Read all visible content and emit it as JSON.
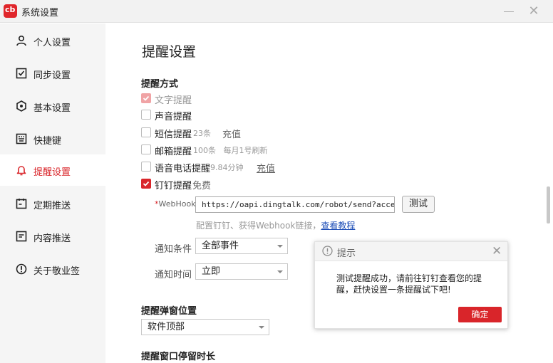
{
  "window": {
    "title": "系统设置"
  },
  "colors": {
    "accent": "#d9252a",
    "link": "#1f4fb8"
  },
  "sidebar": {
    "items": [
      {
        "label": "个人设置",
        "icon": "user-icon"
      },
      {
        "label": "同步设置",
        "icon": "sync-icon"
      },
      {
        "label": "基本设置",
        "icon": "settings-icon"
      },
      {
        "label": "快捷键",
        "icon": "keyboard-icon"
      },
      {
        "label": "提醒设置",
        "icon": "bell-icon",
        "active": true
      },
      {
        "label": "定期推送",
        "icon": "calendar-icon"
      },
      {
        "label": "内容推送",
        "icon": "document-icon"
      },
      {
        "label": "关于敬业签",
        "icon": "info-icon"
      }
    ]
  },
  "main": {
    "page_title": "提醒设置",
    "section_method": "提醒方式",
    "methods": [
      {
        "label": "文字提醒",
        "checked": true,
        "disabled": true
      },
      {
        "label": "声音提醒",
        "checked": false
      },
      {
        "label": "短信提醒",
        "checked": false,
        "note": "23条",
        "action": "充值"
      },
      {
        "label": "邮箱提醒",
        "checked": false,
        "note": "100条   每月1号刷新"
      },
      {
        "label": "语音电话提醒",
        "checked": false,
        "note": "9.84分钟",
        "action": "充值"
      },
      {
        "label": "钉钉提醒",
        "checked": true,
        "note": "免费"
      }
    ],
    "webhook_label": "WebHook",
    "webhook_star": "*",
    "webhook_value": "https://oapi.dingtalk.com/robot/send?access_t",
    "test_button": "测试",
    "hint_text": "配置钉钉、获得Webhook链接，",
    "hint_link": "查看教程",
    "condition_label": "通知条件",
    "condition_value": "全部事件",
    "time_label": "通知时间",
    "time_value": "立即",
    "section_popup": "提醒弹窗位置",
    "popup_value": "软件顶部",
    "section_duration": "提醒窗口停留时长"
  },
  "dialog": {
    "title": "提示",
    "message": "测试提醒成功，请前往钉钉查看您的提醒，赶快设置一条提醒试下吧!",
    "ok": "确定"
  }
}
